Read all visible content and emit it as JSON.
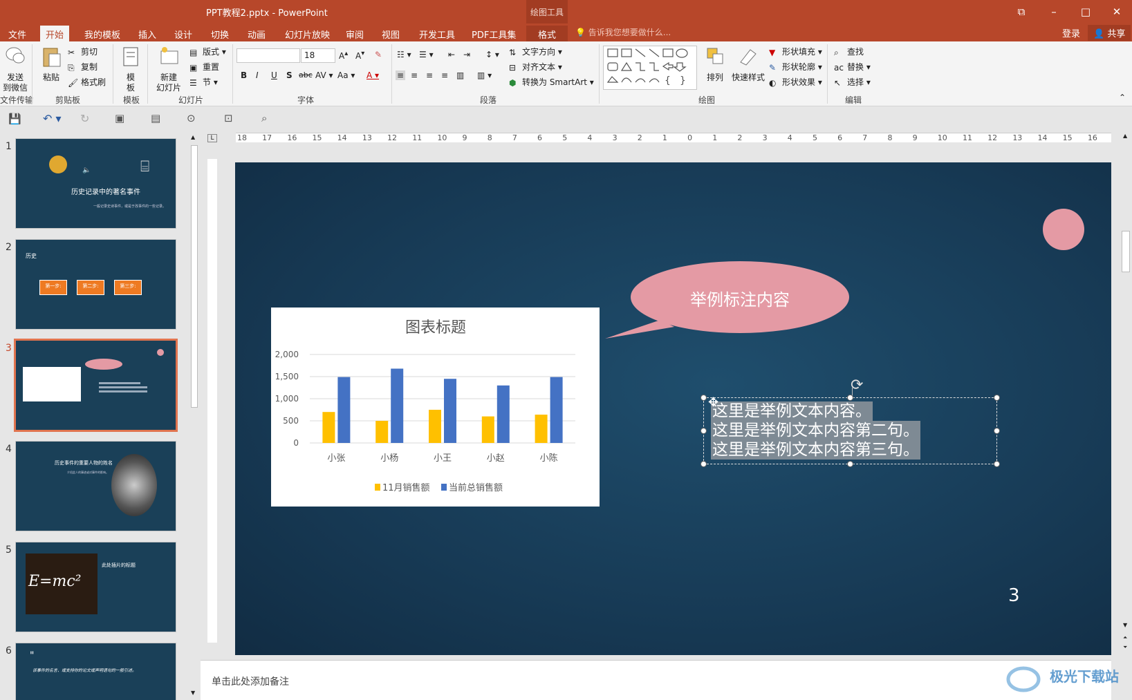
{
  "window": {
    "title": "PPT教程2.pptx - PowerPoint",
    "context_tab": "绘图工具",
    "minimize": "–",
    "maximize": "□",
    "close": "✕"
  },
  "tabs": [
    "文件",
    "开始",
    "我的模板",
    "插入",
    "设计",
    "切换",
    "动画",
    "幻灯片放映",
    "审阅",
    "视图",
    "开发工具",
    "PDF工具集",
    "格式"
  ],
  "tell_me": "告诉我您想要做什么...",
  "login": "登录",
  "share": "共享",
  "ribbon": {
    "send_label": "发送\n到微信",
    "group_file": "文件传输",
    "paste": "粘贴",
    "cut": "剪切",
    "copy": "复制",
    "format_painter": "格式刷",
    "group_clipboard": "剪贴板",
    "template": "模\n板",
    "group_template": "模板",
    "new_slide": "新建\n幻灯片",
    "layout": "版式",
    "reset": "重置",
    "section": "节",
    "group_slides": "幻灯片",
    "font_name": "",
    "font_size": "18",
    "group_font": "字体",
    "text_direction": "文字方向",
    "align_text": "对齐文本",
    "smartart": "转换为 SmartArt",
    "group_paragraph": "段落",
    "arrange": "排列",
    "quick_styles": "快速样式",
    "shape_fill": "形状填充",
    "shape_outline": "形状轮廓",
    "shape_effects": "形状效果",
    "group_drawing": "绘图",
    "find": "查找",
    "replace": "替换",
    "select": "选择",
    "group_editing": "编辑"
  },
  "thumbnails": [
    {
      "num": "1",
      "title": "历史记录中的著名事件",
      "sub": "一般记录史诗事件，或是于改事件的一些记录。"
    },
    {
      "num": "2",
      "title": "历史",
      "steps": [
        "第一步:",
        "第二步:",
        "第三步:"
      ]
    },
    {
      "num": "3"
    },
    {
      "num": "4",
      "title": "历史事件的重要人物的姓名",
      "sub": "介绍此人的事迹或对事件的影响。"
    },
    {
      "num": "5",
      "title": "此处插片的标题",
      "formula": "E=mc²"
    },
    {
      "num": "6",
      "quote": "该事件的名言、或支持你的论文或声明语句的一般引述。"
    }
  ],
  "ruler_numbers": [
    "18",
    "17",
    "16",
    "15",
    "14",
    "13",
    "12",
    "11",
    "10",
    "9",
    "8",
    "7",
    "6",
    "5",
    "4",
    "3",
    "2",
    "1",
    "0",
    "1",
    "2",
    "3",
    "4",
    "5",
    "6",
    "7",
    "8",
    "9",
    "10",
    "11",
    "12",
    "13",
    "14",
    "15",
    "16"
  ],
  "slide": {
    "callout_text": "举例标注内容",
    "text_lines": [
      "这里是举例文本内容。",
      "这里是举例文本内容第二句。",
      "这里是举例文本内容第三句。"
    ],
    "page_number": "3"
  },
  "chart_data": {
    "type": "bar",
    "title": "图表标题",
    "categories": [
      "小张",
      "小杨",
      "小王",
      "小赵",
      "小陈"
    ],
    "series": [
      {
        "name": "11月销售额",
        "color": "#ffc000",
        "values": [
          700,
          500,
          750,
          600,
          640
        ]
      },
      {
        "name": "当前总销售额",
        "color": "#4472c4",
        "values": [
          1490,
          1680,
          1450,
          1300,
          1490
        ]
      }
    ],
    "ylim": [
      0,
      2000
    ],
    "yticks": [
      "2,000",
      "1,500",
      "1,000",
      "500",
      "0"
    ],
    "grid": true,
    "legend": "bottom"
  },
  "notes_placeholder": "单击此处添加备注",
  "watermark": "极光下载站"
}
